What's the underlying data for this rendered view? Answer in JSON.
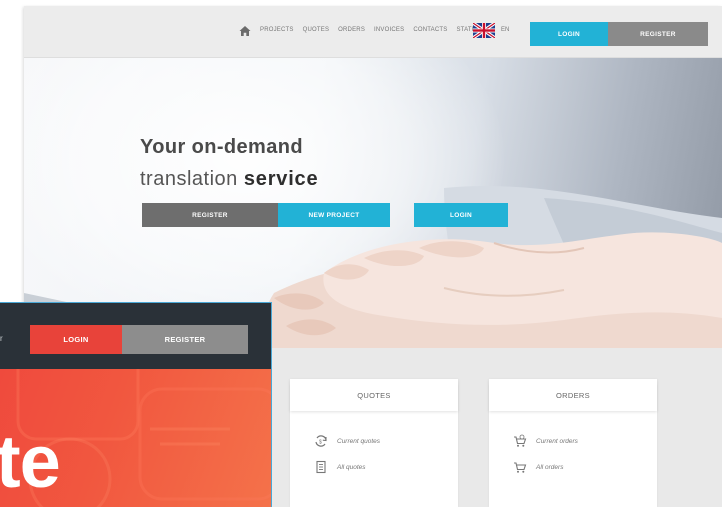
{
  "back": {
    "nav": {
      "links": [
        "PROJECTS",
        "QUOTES",
        "ORDERS",
        "INVOICES",
        "CONTACTS",
        "STATISTICS"
      ],
      "language": "EN",
      "login_label": "LOGIN",
      "register_label": "REGISTER"
    },
    "hero": {
      "title_line1": "Your on-demand",
      "title_line2_normal": "translation",
      "title_line2_bold": "service",
      "register_label": "REGISTER",
      "new_project_label": "NEW PROJECT",
      "login_label": "LOGIN"
    },
    "cards": {
      "quotes": {
        "title": "QUOTES",
        "items": [
          {
            "label": "Current quotes",
            "icon": "current-quotes-icon"
          },
          {
            "label": "All quotes",
            "icon": "all-quotes-icon"
          }
        ]
      },
      "orders": {
        "title": "ORDERS",
        "items": [
          {
            "label": "Current orders",
            "icon": "current-orders-cart-icon"
          },
          {
            "label": "All orders",
            "icon": "all-orders-cart-icon"
          }
        ]
      }
    }
  },
  "front": {
    "nav": {
      "login_label": "LOGIN",
      "register_label": "REGISTER",
      "edge_glyph": "r"
    },
    "hero": {
      "word": "te"
    }
  },
  "colors": {
    "accent_blue": "#22b2d6",
    "gray_button": "#8a8a8a",
    "front_red": "#e8433a",
    "front_nav_dark": "#2a3138"
  }
}
